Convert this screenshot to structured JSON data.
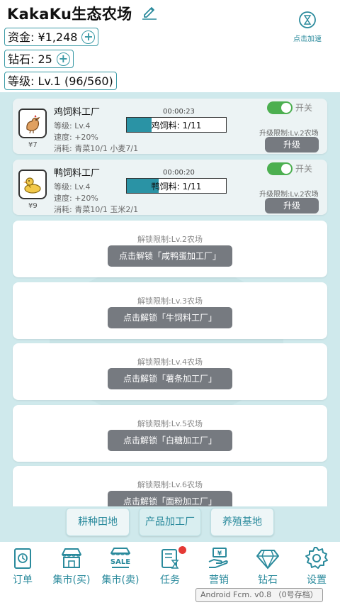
{
  "header": {
    "farm_name": "KakaKu生态农场",
    "speed_label": "点击加速",
    "funds": "资金: ¥1,248",
    "diamonds": "钻石: 25",
    "level": "等级: Lv.1 (96/560)"
  },
  "factories": [
    {
      "name": "鸡饲料工厂",
      "price": "¥7",
      "level": "等级: Lv.4",
      "speed": "速度: +20%",
      "consume": "消耗: 青菜10/1 小麦7/1",
      "timer": "00:00:23",
      "bar_label": "鸡饲料: 1/11",
      "progress": 0.25,
      "toggle_label": "开关",
      "toggle_on": true,
      "upgrade_limit": "升级限制:Lv.2农场",
      "upgrade_button": "升级"
    },
    {
      "name": "鸭饲料工厂",
      "price": "¥9",
      "level": "等级: Lv.4",
      "speed": "速度: +20%",
      "consume": "消耗: 青菜10/1 玉米2/1",
      "timer": "00:00:20",
      "bar_label": "鸭饲料: 1/11",
      "progress": 0.32,
      "toggle_label": "开关",
      "toggle_on": true,
      "upgrade_limit": "升级限制:Lv.2农场",
      "upgrade_button": "升级"
    }
  ],
  "locked_slots": [
    {
      "limit": "解锁限制:Lv.2农场",
      "button": "点击解锁「咸鸭蛋加工厂」"
    },
    {
      "limit": "解锁限制:Lv.3农场",
      "button": "点击解锁「牛饲料工厂」"
    },
    {
      "limit": "解锁限制:Lv.4农场",
      "button": "点击解锁「薯条加工厂」"
    },
    {
      "limit": "解锁限制:Lv.5农场",
      "button": "点击解锁「白糖加工厂」"
    },
    {
      "limit": "解锁限制:Lv.6农场",
      "button": "点击解锁「面粉加工厂」"
    }
  ],
  "tabs": [
    {
      "label": "耕种田地",
      "active": false
    },
    {
      "label": "产品加工厂",
      "active": true
    },
    {
      "label": "养殖基地",
      "active": false
    }
  ],
  "nav": [
    {
      "label": "订单",
      "icon": "order-icon"
    },
    {
      "label": "集市(买)",
      "icon": "market-buy-icon"
    },
    {
      "label": "集市(卖)",
      "icon": "market-sell-icon",
      "icon_text": "SALE"
    },
    {
      "label": "任务",
      "icon": "task-icon",
      "badge": true
    },
    {
      "label": "营销",
      "icon": "marketing-icon",
      "icon_text": "¥"
    },
    {
      "label": "钻石",
      "icon": "diamond-icon"
    },
    {
      "label": "设置",
      "icon": "settings-icon"
    }
  ],
  "version": "Android Fcm. v0.8 （0号存档）",
  "colors": {
    "accent": "#2a8a9c",
    "progress_fill": "#2a93a5",
    "button_gray": "#767a80",
    "toggle_on": "#4caf50",
    "page_bg": "#cfe9ec"
  }
}
